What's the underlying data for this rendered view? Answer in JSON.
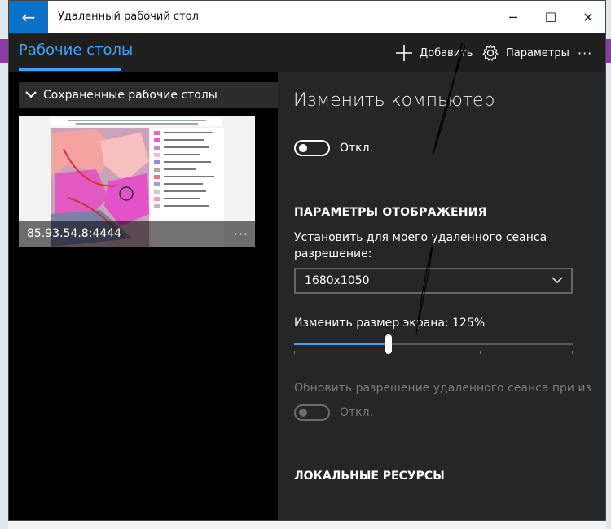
{
  "window": {
    "title": "Удаленный рабочий стол",
    "back_icon": "arrow-left-icon",
    "min_icon": "─",
    "max_icon": "☐",
    "close_icon": "✕"
  },
  "appbar": {
    "tab_label": "Рабочие столы",
    "add_label": "Добавить",
    "settings_label": "Параметры",
    "more_label": "···"
  },
  "left": {
    "section_label": "Сохраненные рабочие столы",
    "tile_caption": "85.93.54.8:4444",
    "tile_more": "···"
  },
  "right": {
    "heading": "Изменить компьютер",
    "toggle1_label": "Откл.",
    "display_section": "ПАРАМЕТРЫ ОТОБРАЖЕНИЯ",
    "resolution_text_line1": "Установить для моего удаленного сеанса",
    "resolution_text_line2": "разрешение:",
    "resolution_value": "1680x1050",
    "scale_label": "Изменить размер экрана: 125%",
    "scale_fraction": 0.34,
    "update_res_label": "Обновить разрешение удаленного сеанса при из",
    "toggle2_label": "Откл.",
    "local_resources": "ЛОКАЛЬНЫЕ РЕСУРСЫ"
  },
  "colors": {
    "accent": "#3ea3ff",
    "back_button": "#0a72c9"
  }
}
